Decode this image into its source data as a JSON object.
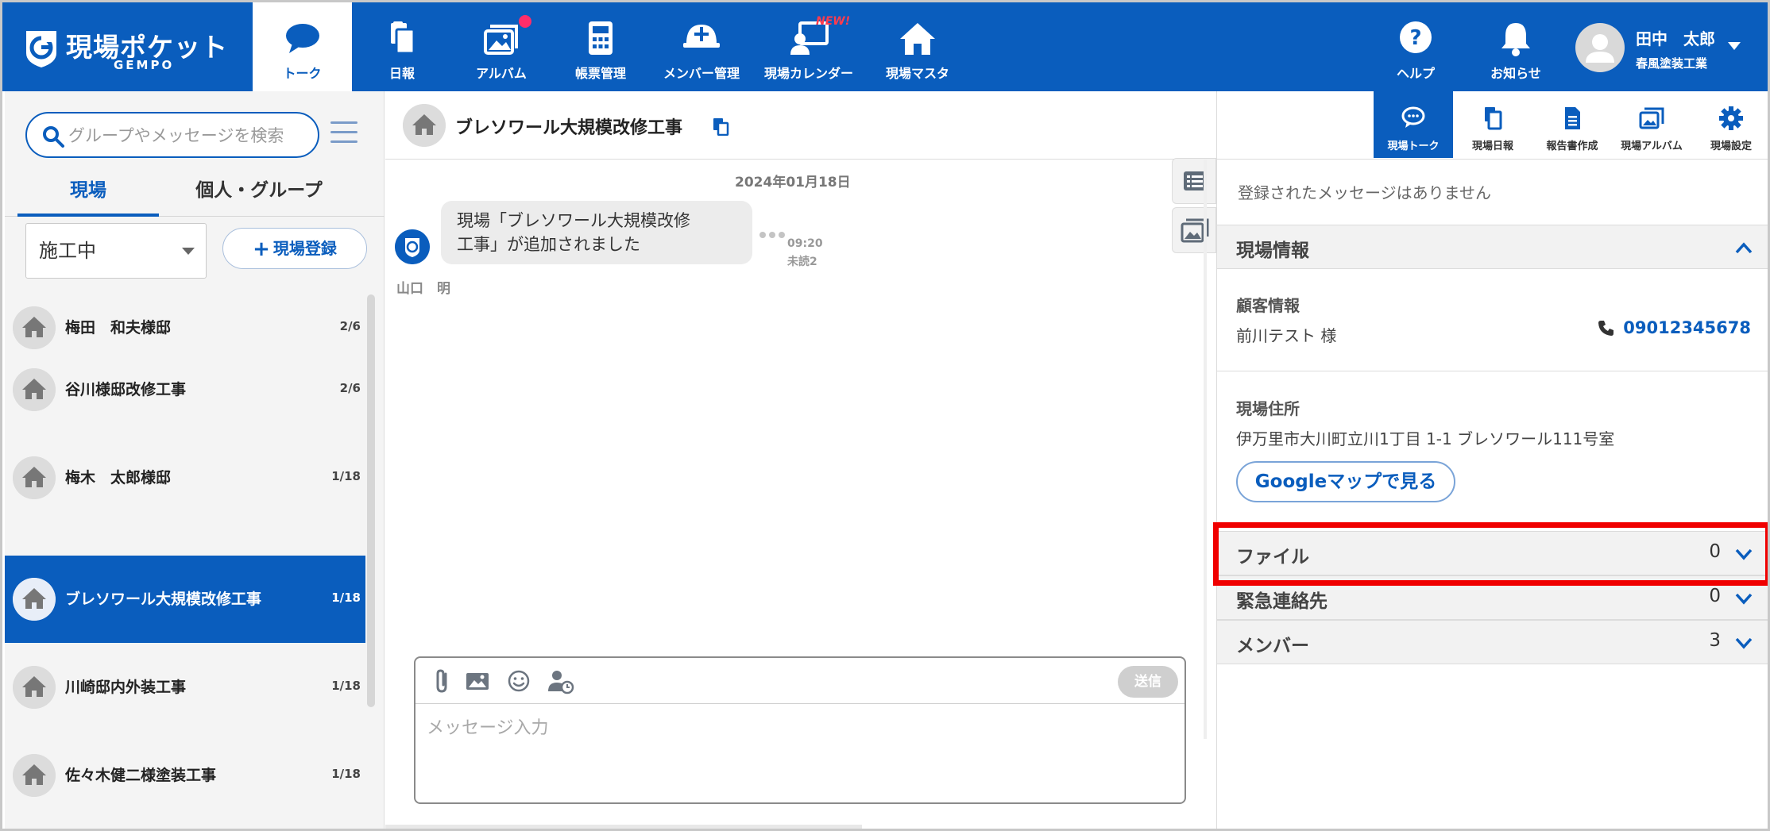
{
  "brand": {
    "name": "現場ポケット",
    "sub": "GEMPO"
  },
  "nav": [
    {
      "label": "トーク",
      "icon": "chat-bubble-icon",
      "active": true
    },
    {
      "label": "日報",
      "icon": "daily-report-icon"
    },
    {
      "label": "アルバム",
      "icon": "album-icon",
      "dot": true
    },
    {
      "label": "帳票管理",
      "icon": "calculator-icon"
    },
    {
      "label": "メンバー管理",
      "icon": "helmet-icon"
    },
    {
      "label": "現場カレンダー",
      "icon": "calendar-screen-icon",
      "badge": "NEW!"
    },
    {
      "label": "現場マスタ",
      "icon": "house-icon"
    }
  ],
  "help": {
    "label": "ヘルプ"
  },
  "notice": {
    "label": "お知らせ"
  },
  "user": {
    "name": "田中　太郎",
    "company": "春風塗装工業"
  },
  "left": {
    "search_placeholder": "グループやメッセージを検索",
    "tabs": [
      "現場",
      "個人・グループ"
    ],
    "status": "施工中",
    "register_label": "現場登録",
    "sites": [
      {
        "name": "梅田　和夫様邸",
        "count": "2/6"
      },
      {
        "name": "谷川様邸改修工事",
        "count": "2/6"
      },
      {
        "name": "梅木　太郎様邸",
        "count": "1/18"
      },
      {
        "name": "ブレソワール大規模改修工事",
        "count": "1/18",
        "selected": true
      },
      {
        "name": "川崎邸内外装工事",
        "count": "1/18"
      },
      {
        "name": "佐々木健二様塗装工事",
        "count": "1/18"
      }
    ]
  },
  "chat": {
    "title": "ブレソワール大規模改修工事",
    "date": "2024年01月18日",
    "message_line1": "現場「ブレソワール大規模改修",
    "message_line2": "工事」が追加されました",
    "time": "09:20",
    "unread": "未読2",
    "sender": "山口　明",
    "send_label": "送信",
    "input_placeholder": "メッセージ入力"
  },
  "right": {
    "tabs": [
      "現場トーク",
      "現場日報",
      "報告書作成",
      "現場アルバム",
      "現場設定"
    ],
    "no_messages": "登録されたメッセージはありません",
    "site_info_title": "現場情報",
    "customer_label": "顧客情報",
    "customer_name": "前川テスト 様",
    "phone": "09012345678",
    "address_label": "現場住所",
    "address": "伊万里市大川町立川1丁目 1-1 ブレソワール111号室",
    "map_button": "Googleマップで見る",
    "files_label": "ファイル",
    "files_count": "0",
    "emergency_label": "緊急連絡先",
    "emergency_count": "0",
    "members_label": "メンバー",
    "members_count": "3"
  },
  "colors": {
    "brand": "#0a5dbd",
    "highlight": "#f00000",
    "badge": "#ff3b4e"
  }
}
